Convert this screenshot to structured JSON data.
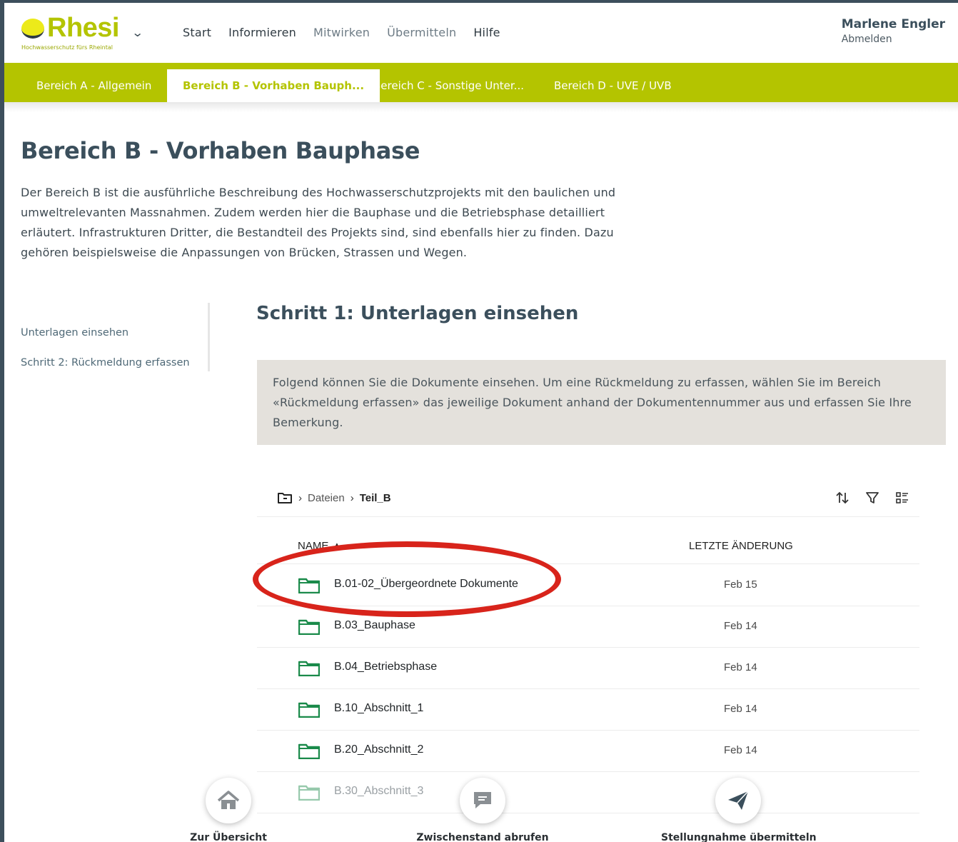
{
  "app": {
    "logo_text": "Rhesi",
    "tagline": "Hochwasserschutz fürs Rheintal"
  },
  "mainnav": [
    "Start",
    "Informieren",
    "Mitwirken",
    "Übermitteln",
    "Hilfe"
  ],
  "user": {
    "name": "Marlene Engler",
    "logout": "Abmelden"
  },
  "subtabs": [
    "Bereich A - Allgemein",
    "Bereich B - Vorhaben Bauph...",
    "Bereich C - Sonstige Unter...",
    "Bereich D - UVE / UVB"
  ],
  "section": {
    "title": "Bereich B - Vorhaben Bauphase",
    "intro": "Der Bereich B ist die ausführliche Beschreibung des Hochwasserschutzprojekts mit den baulichen und umweltrelevanten Massnahmen. Zudem werden hier die Bauphase und die Betriebsphase detailliert erläutert. Infrastrukturen Dritter, die Bestandteil des Projekts sind, sind ebenfalls hier zu finden. Dazu gehören beispielsweise die Anpassungen von Brücken, Strassen und Wegen."
  },
  "sidenav": [
    "Unterlagen einsehen",
    "Schritt 2: Rückmeldung erfassen"
  ],
  "step": {
    "title": "Schritt 1: Unterlagen einsehen",
    "info": "Folgend können Sie die Dokumente einsehen. Um eine Rückmeldung zu erfassen, wählen Sie im Bereich «Rückmeldung erfassen» das jeweilige Dokument anhand der Dokumentennummer aus und erfassen Sie Ihre Bemerkung."
  },
  "filebrowser": {
    "crumb_root": "Dateien",
    "crumb_current": "Teil_B",
    "col_name": "NAME ▲",
    "col_date": "LETZTE ÄNDERUNG",
    "rows": [
      {
        "name": "B.01-02_Übergeordnete Dokumente",
        "date": "Feb 15"
      },
      {
        "name": "B.03_Bauphase",
        "date": "Feb 14"
      },
      {
        "name": "B.04_Betriebsphase",
        "date": "Feb 14"
      },
      {
        "name": "B.10_Abschnitt_1",
        "date": "Feb 14"
      },
      {
        "name": "B.20_Abschnitt_2",
        "date": "Feb 14"
      },
      {
        "name": "B.30_Abschnitt_3",
        "date": ""
      }
    ]
  },
  "actions": [
    "Zur Übersicht",
    "Zwischenstand abrufen",
    "Stellungnahme übermitteln"
  ],
  "colors": {
    "brand": "#b4c400",
    "heading": "#3b4f5c",
    "folder": "#1a8a4a",
    "highlight": "#d8241b"
  }
}
